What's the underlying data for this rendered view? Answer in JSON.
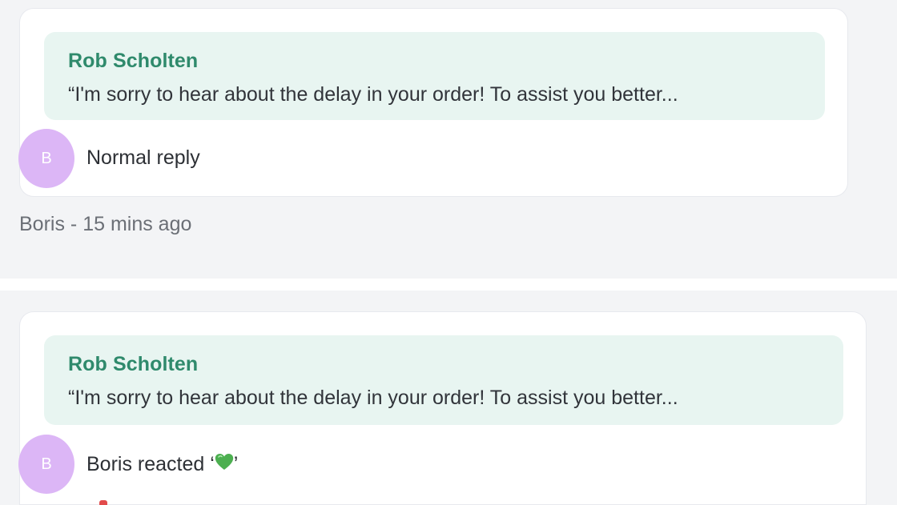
{
  "messages": [
    {
      "quote": {
        "author": "Rob Scholten",
        "text": "“I'm sorry to hear about the delay in your order! To assist you better..."
      },
      "avatar_initial": "B",
      "body": "Normal reply",
      "meta": {
        "author": "Boris",
        "separator": " - ",
        "time": "15 mins ago"
      }
    },
    {
      "quote": {
        "author": "Rob Scholten",
        "text": "“I'm sorry to hear about the delay in your order! To assist you better..."
      },
      "avatar_initial": "B",
      "body_prefix": "Boris reacted ‘",
      "reaction_icon": "green-heart-icon",
      "body_suffix": "’"
    }
  ],
  "colors": {
    "quote_author": "#2f8a6c",
    "quote_background": "#e8f5f1",
    "avatar": "#dcb6f6",
    "panel_background": "#f3f4f6"
  }
}
